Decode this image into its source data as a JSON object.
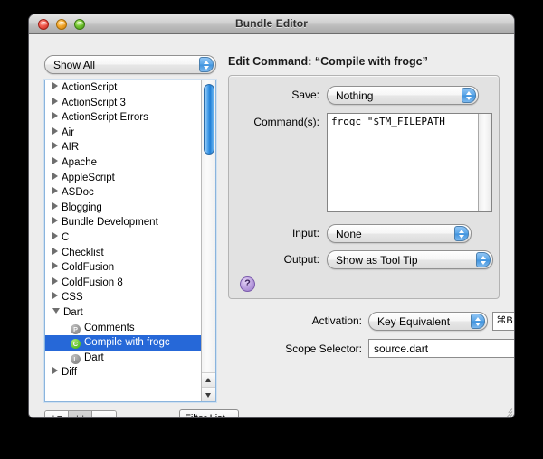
{
  "window": {
    "title": "Bundle Editor",
    "traffic_lights": [
      "close",
      "minimize",
      "zoom"
    ]
  },
  "left": {
    "filter_popup": {
      "value": "Show All"
    },
    "tree": [
      {
        "label": "ActionScript",
        "type": "group",
        "expanded": false
      },
      {
        "label": "ActionScript 3",
        "type": "group",
        "expanded": false
      },
      {
        "label": "ActionScript Errors",
        "type": "group",
        "expanded": false
      },
      {
        "label": "Air",
        "type": "group",
        "expanded": false
      },
      {
        "label": "AIR",
        "type": "group",
        "expanded": false
      },
      {
        "label": "Apache",
        "type": "group",
        "expanded": false
      },
      {
        "label": "AppleScript",
        "type": "group",
        "expanded": false
      },
      {
        "label": "ASDoc",
        "type": "group",
        "expanded": false
      },
      {
        "label": "Blogging",
        "type": "group",
        "expanded": false
      },
      {
        "label": "Bundle Development",
        "type": "group",
        "expanded": false
      },
      {
        "label": "C",
        "type": "group",
        "expanded": false
      },
      {
        "label": "Checklist",
        "type": "group",
        "expanded": false
      },
      {
        "label": "ColdFusion",
        "type": "group",
        "expanded": false
      },
      {
        "label": "ColdFusion 8",
        "type": "group",
        "expanded": false
      },
      {
        "label": "CSS",
        "type": "group",
        "expanded": false
      },
      {
        "label": "Dart",
        "type": "group",
        "expanded": true
      },
      {
        "label": "Comments",
        "type": "item",
        "badge": "P",
        "badge_color": "gray",
        "selected": false
      },
      {
        "label": "Compile with frogc",
        "type": "item",
        "badge": "C",
        "badge_color": "green",
        "selected": true
      },
      {
        "label": "Dart",
        "type": "item",
        "badge": "L",
        "badge_color": "gray",
        "selected": false
      },
      {
        "label": "Diff",
        "type": "group",
        "expanded": false
      }
    ],
    "toolbar": {
      "add_label": "+",
      "duplicate_label": "++",
      "remove_label": "−",
      "filter_button_label": "Filter List..."
    }
  },
  "right": {
    "heading": "Edit Command: “Compile with frogc”",
    "save": {
      "label": "Save:",
      "value": "Nothing"
    },
    "commands": {
      "label": "Command(s):",
      "value": "frogc \"$TM_FILEPATH"
    },
    "input": {
      "label": "Input:",
      "value": "None"
    },
    "output": {
      "label": "Output:",
      "value": "Show as Tool Tip"
    },
    "help_label": "?",
    "activation": {
      "label": "Activation:",
      "value": "Key Equivalent",
      "key_equivalent": "⌘B"
    },
    "scope": {
      "label": "Scope Selector:",
      "value": "source.dart"
    }
  },
  "colors": {
    "selection_blue": "#2668d8",
    "badge_green": "#5cc62a",
    "badge_gray": "#8d8d8d",
    "help_purple": "#9a78cb",
    "window_bg": "#ededed"
  }
}
